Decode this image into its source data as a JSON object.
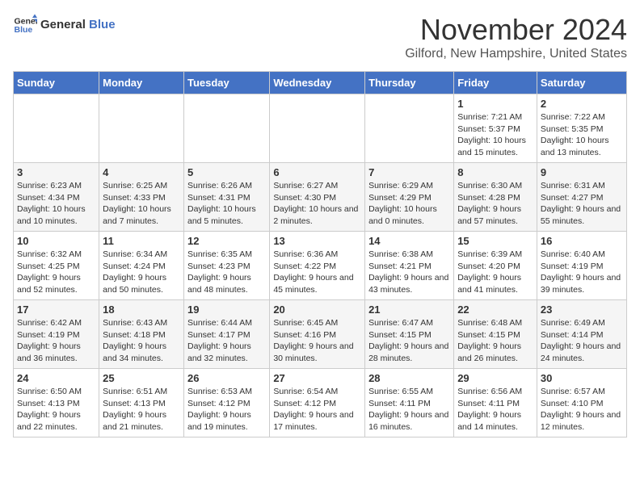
{
  "logo": {
    "line1": "General",
    "line2": "Blue"
  },
  "title": "November 2024",
  "location": "Gilford, New Hampshire, United States",
  "days_of_week": [
    "Sunday",
    "Monday",
    "Tuesday",
    "Wednesday",
    "Thursday",
    "Friday",
    "Saturday"
  ],
  "weeks": [
    [
      {
        "day": "",
        "info": ""
      },
      {
        "day": "",
        "info": ""
      },
      {
        "day": "",
        "info": ""
      },
      {
        "day": "",
        "info": ""
      },
      {
        "day": "",
        "info": ""
      },
      {
        "day": "1",
        "info": "Sunrise: 7:21 AM\nSunset: 5:37 PM\nDaylight: 10 hours and 15 minutes."
      },
      {
        "day": "2",
        "info": "Sunrise: 7:22 AM\nSunset: 5:35 PM\nDaylight: 10 hours and 13 minutes."
      }
    ],
    [
      {
        "day": "3",
        "info": "Sunrise: 6:23 AM\nSunset: 4:34 PM\nDaylight: 10 hours and 10 minutes."
      },
      {
        "day": "4",
        "info": "Sunrise: 6:25 AM\nSunset: 4:33 PM\nDaylight: 10 hours and 7 minutes."
      },
      {
        "day": "5",
        "info": "Sunrise: 6:26 AM\nSunset: 4:31 PM\nDaylight: 10 hours and 5 minutes."
      },
      {
        "day": "6",
        "info": "Sunrise: 6:27 AM\nSunset: 4:30 PM\nDaylight: 10 hours and 2 minutes."
      },
      {
        "day": "7",
        "info": "Sunrise: 6:29 AM\nSunset: 4:29 PM\nDaylight: 10 hours and 0 minutes."
      },
      {
        "day": "8",
        "info": "Sunrise: 6:30 AM\nSunset: 4:28 PM\nDaylight: 9 hours and 57 minutes."
      },
      {
        "day": "9",
        "info": "Sunrise: 6:31 AM\nSunset: 4:27 PM\nDaylight: 9 hours and 55 minutes."
      }
    ],
    [
      {
        "day": "10",
        "info": "Sunrise: 6:32 AM\nSunset: 4:25 PM\nDaylight: 9 hours and 52 minutes."
      },
      {
        "day": "11",
        "info": "Sunrise: 6:34 AM\nSunset: 4:24 PM\nDaylight: 9 hours and 50 minutes."
      },
      {
        "day": "12",
        "info": "Sunrise: 6:35 AM\nSunset: 4:23 PM\nDaylight: 9 hours and 48 minutes."
      },
      {
        "day": "13",
        "info": "Sunrise: 6:36 AM\nSunset: 4:22 PM\nDaylight: 9 hours and 45 minutes."
      },
      {
        "day": "14",
        "info": "Sunrise: 6:38 AM\nSunset: 4:21 PM\nDaylight: 9 hours and 43 minutes."
      },
      {
        "day": "15",
        "info": "Sunrise: 6:39 AM\nSunset: 4:20 PM\nDaylight: 9 hours and 41 minutes."
      },
      {
        "day": "16",
        "info": "Sunrise: 6:40 AM\nSunset: 4:19 PM\nDaylight: 9 hours and 39 minutes."
      }
    ],
    [
      {
        "day": "17",
        "info": "Sunrise: 6:42 AM\nSunset: 4:19 PM\nDaylight: 9 hours and 36 minutes."
      },
      {
        "day": "18",
        "info": "Sunrise: 6:43 AM\nSunset: 4:18 PM\nDaylight: 9 hours and 34 minutes."
      },
      {
        "day": "19",
        "info": "Sunrise: 6:44 AM\nSunset: 4:17 PM\nDaylight: 9 hours and 32 minutes."
      },
      {
        "day": "20",
        "info": "Sunrise: 6:45 AM\nSunset: 4:16 PM\nDaylight: 9 hours and 30 minutes."
      },
      {
        "day": "21",
        "info": "Sunrise: 6:47 AM\nSunset: 4:15 PM\nDaylight: 9 hours and 28 minutes."
      },
      {
        "day": "22",
        "info": "Sunrise: 6:48 AM\nSunset: 4:15 PM\nDaylight: 9 hours and 26 minutes."
      },
      {
        "day": "23",
        "info": "Sunrise: 6:49 AM\nSunset: 4:14 PM\nDaylight: 9 hours and 24 minutes."
      }
    ],
    [
      {
        "day": "24",
        "info": "Sunrise: 6:50 AM\nSunset: 4:13 PM\nDaylight: 9 hours and 22 minutes."
      },
      {
        "day": "25",
        "info": "Sunrise: 6:51 AM\nSunset: 4:13 PM\nDaylight: 9 hours and 21 minutes."
      },
      {
        "day": "26",
        "info": "Sunrise: 6:53 AM\nSunset: 4:12 PM\nDaylight: 9 hours and 19 minutes."
      },
      {
        "day": "27",
        "info": "Sunrise: 6:54 AM\nSunset: 4:12 PM\nDaylight: 9 hours and 17 minutes."
      },
      {
        "day": "28",
        "info": "Sunrise: 6:55 AM\nSunset: 4:11 PM\nDaylight: 9 hours and 16 minutes."
      },
      {
        "day": "29",
        "info": "Sunrise: 6:56 AM\nSunset: 4:11 PM\nDaylight: 9 hours and 14 minutes."
      },
      {
        "day": "30",
        "info": "Sunrise: 6:57 AM\nSunset: 4:10 PM\nDaylight: 9 hours and 12 minutes."
      }
    ]
  ]
}
